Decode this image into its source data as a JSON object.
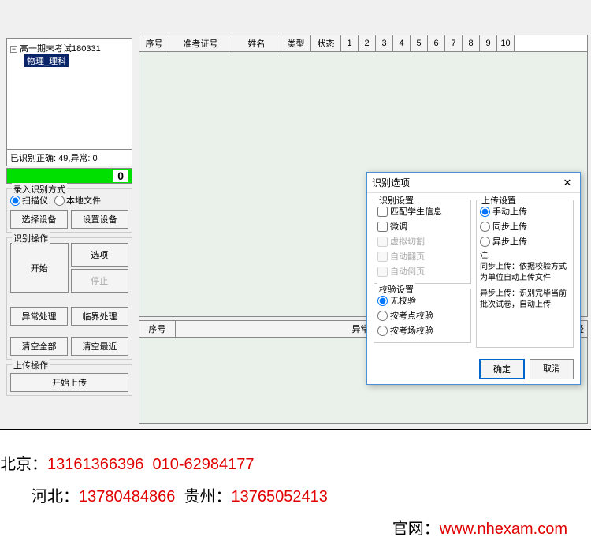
{
  "tree": {
    "root": "高一期末考试180331",
    "child": "物理_理科"
  },
  "status_line": "已识别正确: 49,异常: 0",
  "counter": "0",
  "input_mode": {
    "title": "录入识别方式",
    "scanner": "扫描仪",
    "local": "本地文件",
    "select_device": "选择设备",
    "config_device": "设置设备"
  },
  "ops": {
    "title": "识别操作",
    "start": "开始",
    "options": "选项",
    "stop": "停止",
    "exception": "异常处理",
    "boundary": "临界处理",
    "clear_all": "清空全部",
    "clear_recent": "清空最近"
  },
  "upload_ops": {
    "title": "上传操作",
    "start_upload": "开始上传"
  },
  "table1": {
    "cols": [
      "序号",
      "准考证号",
      "姓名",
      "类型",
      "状态",
      "1",
      "2",
      "3",
      "4",
      "5",
      "6",
      "7",
      "8",
      "9",
      "10"
    ]
  },
  "table2": {
    "cols": [
      "序号",
      "异常描述"
    ],
    "right": "路径"
  },
  "dialog": {
    "title": "识别选项",
    "recog": {
      "title": "识别设置",
      "match_student": "匹配学生信息",
      "fine_tune": "微调",
      "virtual_cut": "虚拟切割",
      "auto_flip": "自动翻页",
      "auto_reverse": "自动倒页"
    },
    "verify": {
      "title": "校验设置",
      "none": "无校验",
      "by_point": "按考点校验",
      "by_room": "按考场校验"
    },
    "upload": {
      "title": "上传设置",
      "manual": "手动上传",
      "sync": "同步上传",
      "async": "异步上传",
      "note_label": "注:",
      "note_sync": "同步上传：依据校验方式为单位自动上传文件",
      "note_async": "异步上传：识别完毕当前批次试卷，自动上传"
    },
    "ok": "确定",
    "cancel": "取消"
  },
  "contact": {
    "beijing_label": "北京：",
    "beijing_phone": "13161366396",
    "beijing_tel": "010-62984177",
    "hebei_label": "河北：",
    "hebei_phone": "13780484866",
    "guizhou_label": "贵州：",
    "guizhou_phone": "13765052413",
    "site_label": "官网：",
    "site_url": "www.nhexam.com"
  }
}
